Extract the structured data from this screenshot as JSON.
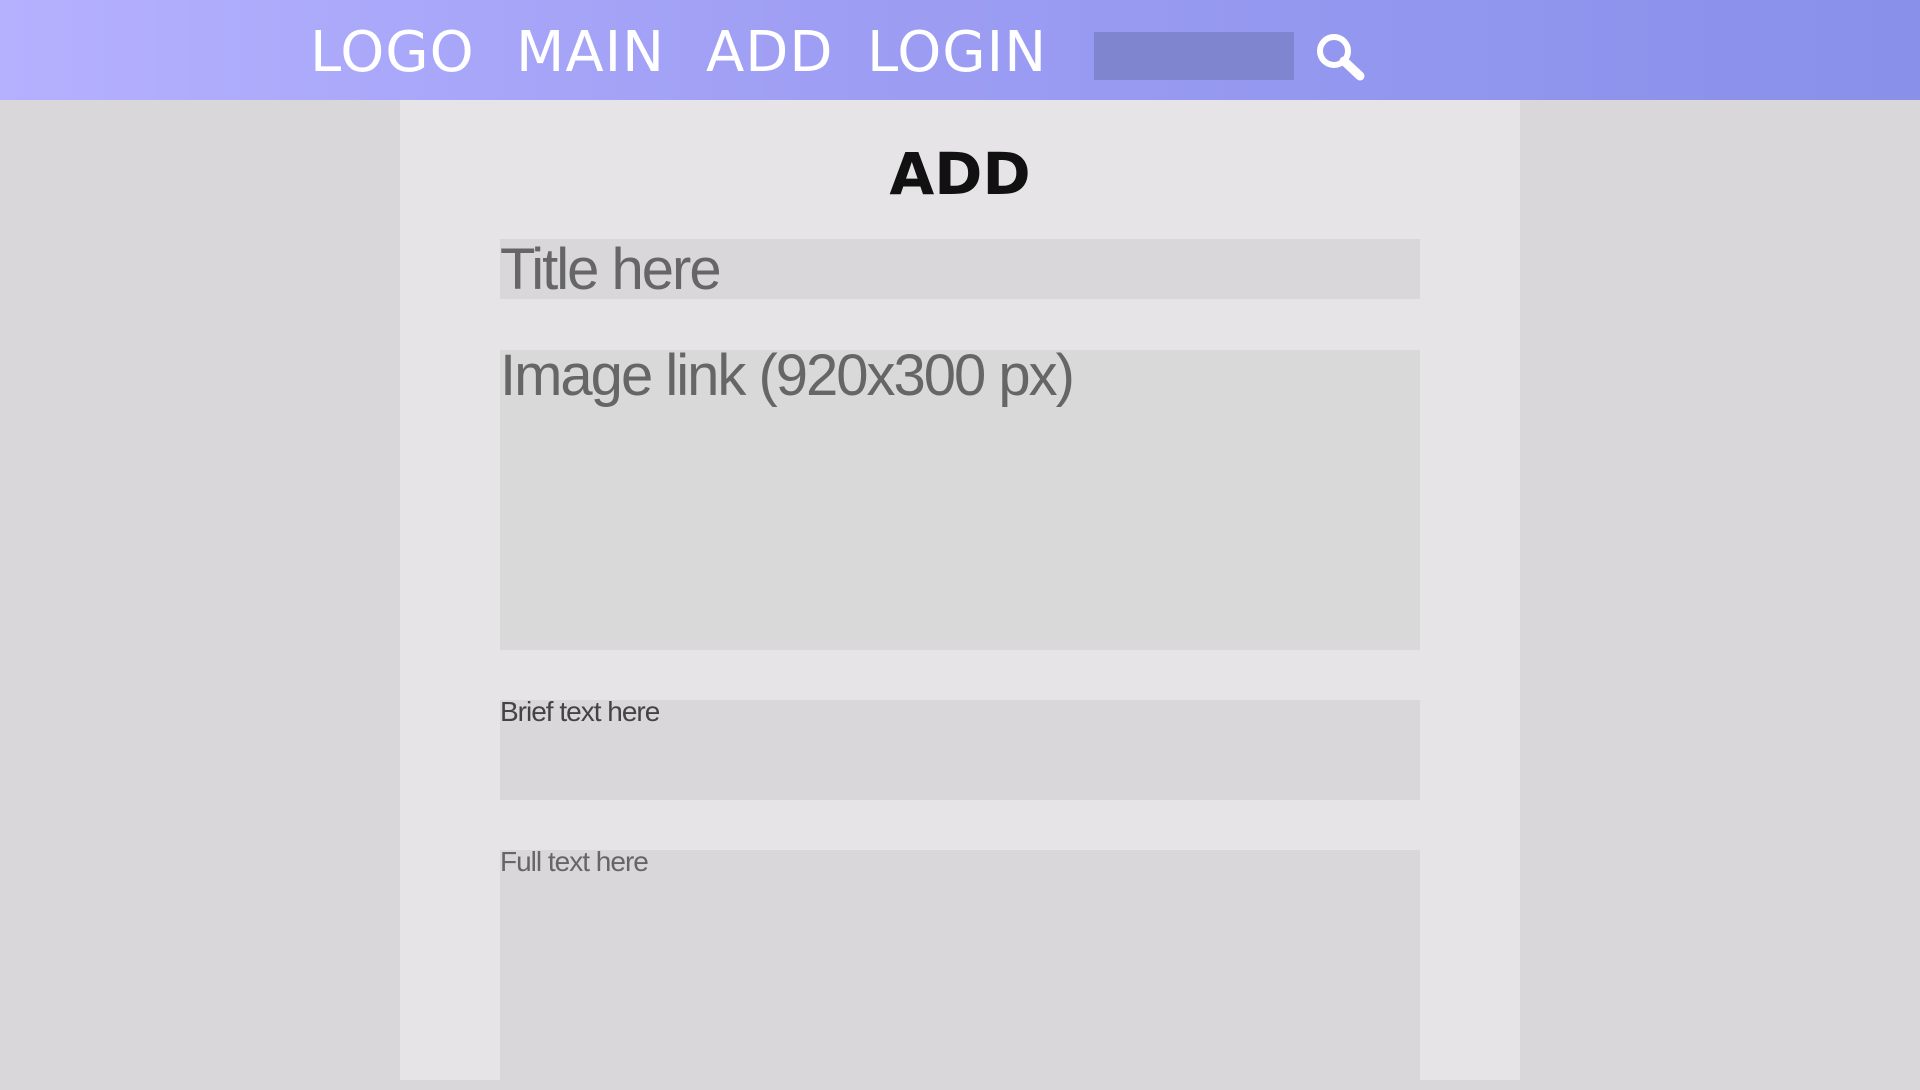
{
  "nav": {
    "logo": "LOGO",
    "main": "MAIN",
    "add": "ADD",
    "login": "LOGIN",
    "search_icon": "search-icon"
  },
  "page": {
    "title": "ADD"
  },
  "form": {
    "title_placeholder": "Title here",
    "image_placeholder": "Image link (920x300 px)",
    "brief_placeholder": "Brief text here",
    "full_placeholder": "Full text here"
  },
  "colors": {
    "navbar_start": "#b5b1ff",
    "navbar_end": "#8890ea",
    "search_box": "#7f85cf",
    "panel": "#e6e4e7",
    "field": "#d9d7da",
    "background": "#d9d7da"
  }
}
